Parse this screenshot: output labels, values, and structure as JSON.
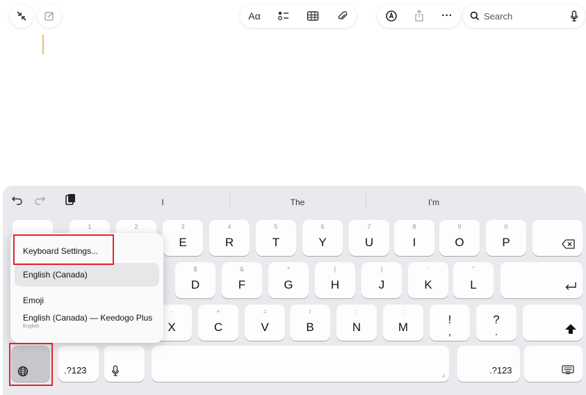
{
  "toolbar": {
    "format_label": "Aα",
    "search_placeholder": "Search"
  },
  "suggestions": [
    "I",
    "The",
    "I’m"
  ],
  "keyboard": {
    "row1": [
      {
        "main": "",
        "alt": "1"
      },
      {
        "main": "",
        "alt": "2"
      },
      {
        "main": "E",
        "alt": "3"
      },
      {
        "main": "R",
        "alt": "4"
      },
      {
        "main": "T",
        "alt": "5"
      },
      {
        "main": "Y",
        "alt": "6"
      },
      {
        "main": "U",
        "alt": "7"
      },
      {
        "main": "I",
        "alt": "8"
      },
      {
        "main": "O",
        "alt": "9"
      },
      {
        "main": "P",
        "alt": "0"
      }
    ],
    "row2": [
      {
        "main": "D",
        "alt": "$"
      },
      {
        "main": "F",
        "alt": "&"
      },
      {
        "main": "G",
        "alt": "*"
      },
      {
        "main": "H",
        "alt": "("
      },
      {
        "main": "J",
        "alt": ")"
      },
      {
        "main": "K",
        "alt": "’"
      },
      {
        "main": "L",
        "alt": "\""
      }
    ],
    "row3": [
      {
        "main": "X",
        "alt": "-"
      },
      {
        "main": "C",
        "alt": "+"
      },
      {
        "main": "V",
        "alt": "="
      },
      {
        "main": "B",
        "alt": "/"
      },
      {
        "main": "N",
        "alt": ";"
      },
      {
        "main": "M",
        "alt": ":"
      },
      {
        "main": "!",
        "alt": ""
      },
      {
        "main": "?",
        "alt": ""
      }
    ],
    "punct_under_excl": ",",
    "punct_under_q": ".",
    "numbers_label": ".?123",
    "numbers_label_right": ".?123",
    "space_hint": "A"
  },
  "language_menu": {
    "items": [
      {
        "label": "Keyboard Settings...",
        "sub": ""
      },
      {
        "label": "English (Canada)",
        "sub": ""
      },
      {
        "label": "Emoji",
        "sub": ""
      },
      {
        "label": "English (Canada) — Keedogo Plus",
        "sub": "English"
      }
    ],
    "selected_index": 1
  },
  "colors": {
    "highlight": "#e3252b",
    "caret": "#e8c06a",
    "keyboard_bg": "#e9e9ee"
  }
}
